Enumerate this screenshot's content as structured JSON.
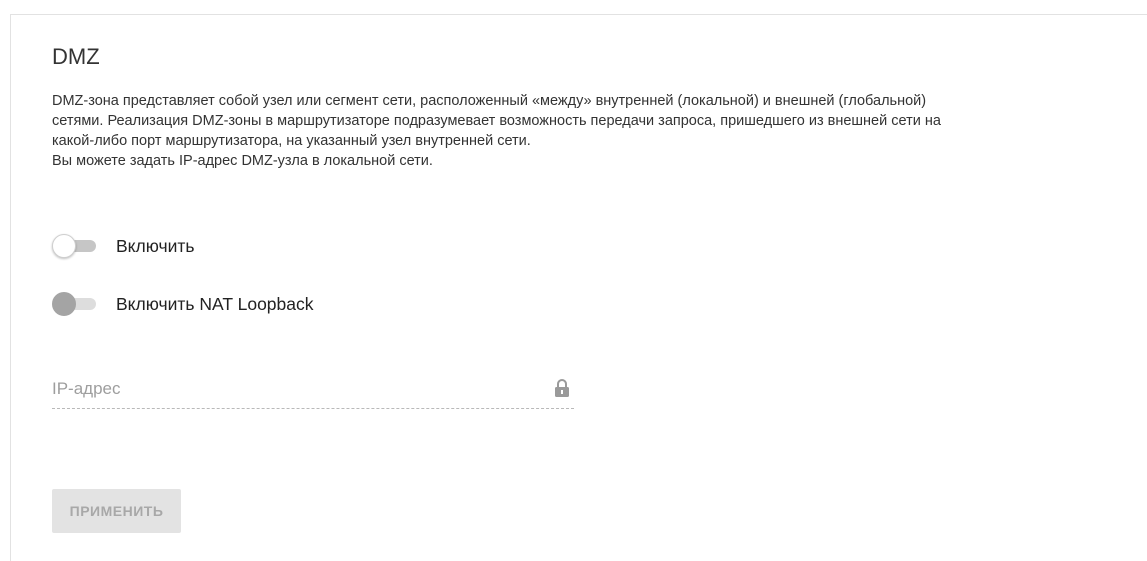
{
  "section": {
    "title": "DMZ",
    "description_lines": [
      "DMZ-зона представляет собой узел или сегмент сети, расположенный «между» внутренней (локальной) и внешней (глобальной)",
      "сетями. Реализация DMZ-зоны в маршрутизаторе подразумевает возможность передачи запроса, пришедшего из внешней сети на",
      "какой-либо порт маршрутизатора, на указанный узел внутренней сети.",
      "Вы можете задать IP-адрес DMZ-узла в локальной сети."
    ]
  },
  "toggles": {
    "enable": {
      "label": "Включить",
      "checked": false,
      "disabled": false
    },
    "nat_loopback": {
      "label": "Включить NAT Loopback",
      "checked": false,
      "disabled": true
    }
  },
  "ip_field": {
    "placeholder": "IP-адрес",
    "value": "",
    "icon": "lock-icon"
  },
  "apply_button": {
    "label": "ПРИМЕНИТЬ",
    "disabled": true
  }
}
